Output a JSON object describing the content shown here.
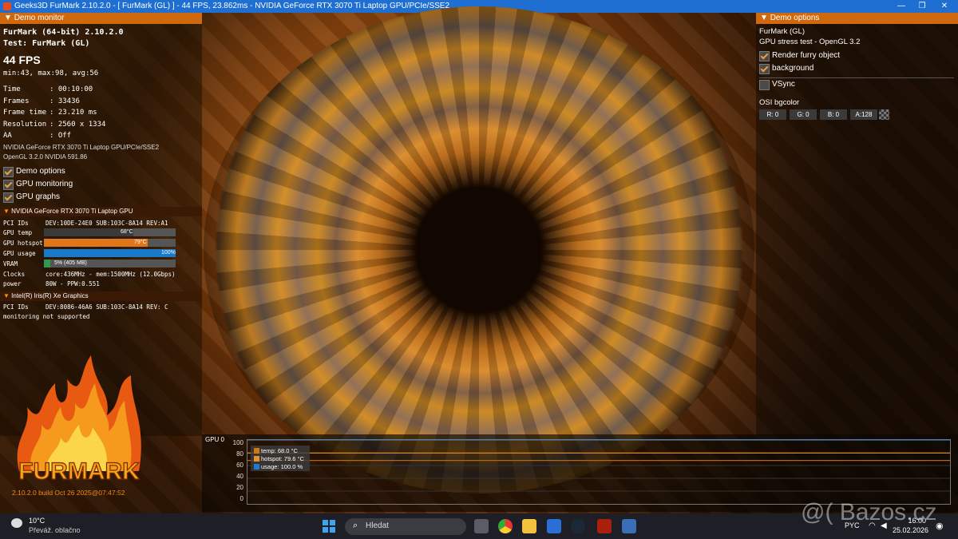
{
  "window": {
    "title": "Geeks3D FurMark 2.10.2.0 - [ FurMark (GL) ] - 44 FPS, 23.862ms - NVIDIA GeForce RTX 3070 Ti Laptop GPU/PCIe/SSE2",
    "minimize": "—",
    "maximize": "❐",
    "close": "✕"
  },
  "demo_monitor": {
    "header": "Demo monitor",
    "name_line": "FurMark (64-bit) 2.10.2.0",
    "test_line": "Test: FurMark (GL)",
    "fps": "44 FPS",
    "fps_stats": "min:43, max:98, avg:56",
    "stats": [
      {
        "label": "Time",
        "value": ": 00:10:00"
      },
      {
        "label": "Frames",
        "value": ": 33436"
      },
      {
        "label": "Frame time",
        "value": ": 23.210 ms"
      },
      {
        "label": "Resolution",
        "value": ": 2560 x 1334"
      },
      {
        "label": "AA",
        "value": ": Off"
      }
    ],
    "gpu_line": "NVIDIA GeForce RTX 3070 Ti Laptop GPU/PCIe/SSE2",
    "gl_line": "OpenGL 3.2.0 NVIDIA 591.86",
    "options": [
      {
        "label": "Demo options",
        "checked": true
      },
      {
        "label": "GPU monitoring",
        "checked": true
      },
      {
        "label": "GPU graphs",
        "checked": true
      }
    ]
  },
  "gpu1": {
    "title": "NVIDIA GeForce RTX 3070 Ti Laptop GPU",
    "pci_label": "PCI IDs",
    "pci_value": "DEV:10DE-24E0 SUB:103C-8A14 REV:A1",
    "temp_label": "GPU temp",
    "temp_text": "68°C",
    "temp_level": 0.68,
    "hotspot_label": "GPU hotspot",
    "hotspot_text": "79°C",
    "hotspot_level": 0.79,
    "usage_label": "GPU usage",
    "usage_text": "100%",
    "usage_level": 1.0,
    "vram_label": "VRAM",
    "vram_text": "5% (405 MB)",
    "vram_level": 0.05,
    "clocks_label": "Clocks",
    "clocks_value": "core:436MHz - mem:1500MHz (12.0Gbps)",
    "power_label": "power",
    "power_value": "80W - PPW:0.551"
  },
  "gpu2": {
    "title": "Intel(R) Iris(R) Xe Graphics",
    "pci_label": "PCI IDs",
    "pci_value": "DEV:8086-46A6 SUB:103C-8A14 REV: C",
    "note": "monitoring not supported"
  },
  "logo": {
    "text": "FURMARK"
  },
  "build": "2.10.2.0 build Oct 26 2025@07:47:52",
  "demo_options": {
    "header": "Demo options",
    "title": "FurMark (GL)",
    "subtitle": "GPU stress test - OpenGL 3.2",
    "checks": [
      {
        "label": "Render furry object",
        "checked": true
      },
      {
        "label": "background",
        "checked": true
      },
      {
        "label": "VSync",
        "checked": false
      }
    ],
    "bgcolor_label": "OSI bgcolor",
    "rgba": [
      "R: 0",
      "G: 0",
      "B: 0",
      "A:128"
    ]
  },
  "graph": {
    "title": "GPU 0",
    "yticks": [
      "100",
      "80",
      "60",
      "40",
      "20",
      "0"
    ],
    "legend": [
      {
        "label": "temp: 68.0 °C",
        "color": "#d07818"
      },
      {
        "label": "hotspot: 79.6 °C",
        "color": "#e8902a"
      },
      {
        "label": "usage: 100.0 %",
        "color": "#1f7ad0"
      }
    ],
    "series": {
      "temp": 68.0,
      "hotspot": 79.6,
      "usage": 100.0
    }
  },
  "taskbar": {
    "weather_temp": "10°C",
    "weather_desc": "Převáž. oblačno",
    "search_placeholder": "Hledat",
    "lang": "PYC",
    "time": "16:00",
    "date": "25.02.2026"
  },
  "watermark": "@( Bazos.cz"
}
